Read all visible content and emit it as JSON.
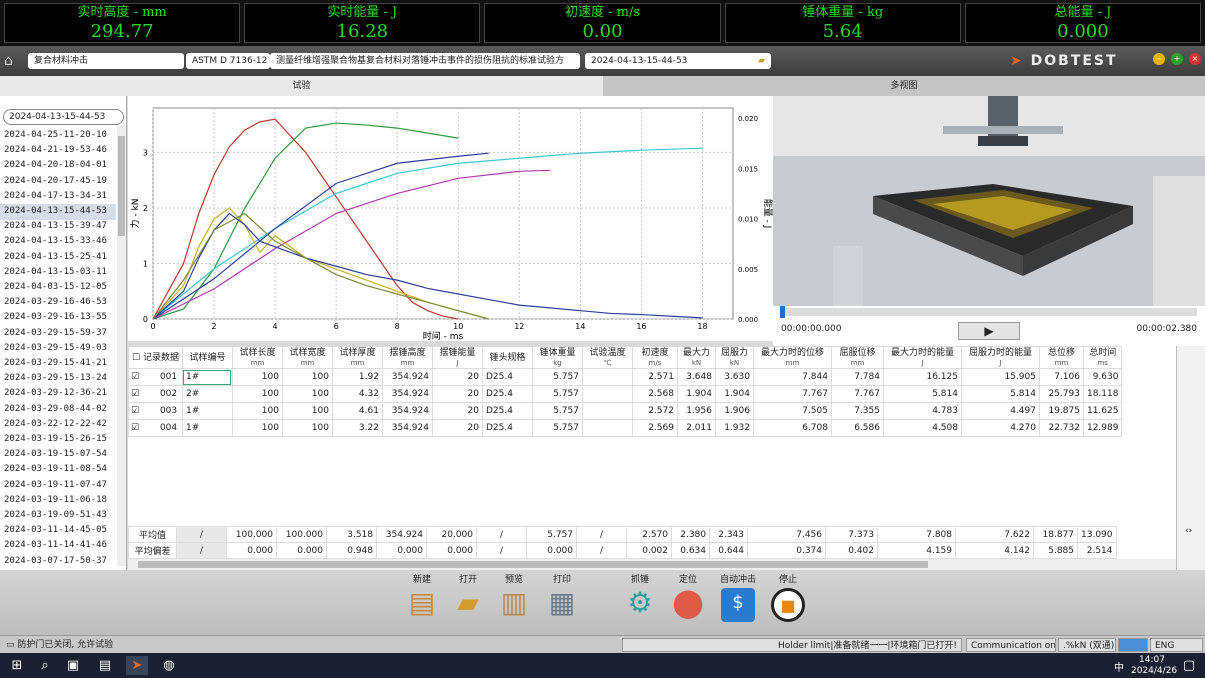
{
  "meters": [
    {
      "label": "实时高度 - mm",
      "value": "294.77"
    },
    {
      "label": "实时能量 - J",
      "value": "16.28"
    },
    {
      "label": "初速度 - m/s",
      "value": "0.00"
    },
    {
      "label": "锤体重量 - kg",
      "value": "5.64"
    },
    {
      "label": "总能量 - J",
      "value": "0.000"
    }
  ],
  "toolbar": {
    "material": "复合材料冲击",
    "standard": "ASTM D 7136-12",
    "standard_desc": "测量纤维增强聚合物基复合材料对落锤冲击事件的损伤阻抗的标准试验方",
    "record": "2024-04-13-15-44-53",
    "logo": "DOBTEST"
  },
  "tabs": {
    "test": "试验",
    "multi": "多视图"
  },
  "list": {
    "search": "2024-04-13-15-44-53",
    "items": [
      "2024-04-25-11-20-10",
      "2024-04-21-19-53-46",
      "2024-04-20-18-04-01",
      "2024-04-20-17-45-19",
      "2024-04-17-13-34-31",
      "2024-04-13-15-44-53",
      "2024-04-13-15-39-47",
      "2024-04-13-15-33-46",
      "2024-04-13-15-25-41",
      "2024-04-13-15-03-11",
      "2024-04-03-15-12-05",
      "2024-03-29-16-46-53",
      "2024-03-29-16-13-55",
      "2024-03-29-15-59-37",
      "2024-03-29-15-49-03",
      "2024-03-29-15-41-21",
      "2024-03-29-15-13-24",
      "2024-03-29-12-36-21",
      "2024-03-29-08-44-02",
      "2024-03-22-12-22-42",
      "2024-03-19-15-26-15",
      "2024-03-19-15-07-54",
      "2024-03-19-11-08-54",
      "2024-03-19-11-07-47",
      "2024-03-19-11-06-18",
      "2024-03-19-09-51-43",
      "2024-03-11-14-45-05",
      "2024-03-11-14-41-46",
      "2024-03-07-17-50-37"
    ],
    "selected": 5
  },
  "chart_data": {
    "type": "line",
    "xlabel": "时间 - ms",
    "ylabel": "力 - kN",
    "y2label": "能量 - J",
    "xlim": [
      0,
      19
    ],
    "ylim": [
      0,
      3.8
    ],
    "y2lim": [
      0,
      0.021
    ],
    "xticks": [
      "0",
      "2",
      "4",
      "6",
      "8",
      "10",
      "12",
      "14",
      "16",
      "18"
    ],
    "yticks": [
      "0",
      "1",
      "2",
      "3"
    ],
    "y2ticks": [
      "0.000",
      "0.005",
      "0.010",
      "0.015",
      "0.020"
    ],
    "series": [
      {
        "color": "#c0392b",
        "axis": "force",
        "x": [
          0,
          1,
          1.5,
          2,
          2.5,
          3,
          3.5,
          4,
          4.5,
          5,
          5.5,
          6,
          6.5,
          7,
          7.5,
          8,
          8.5,
          9,
          9.5,
          10
        ],
        "y": [
          0,
          1,
          1.9,
          2.6,
          3.1,
          3.4,
          3.55,
          3.6,
          3.3,
          3.0,
          2.6,
          2.2,
          1.8,
          1.4,
          1.0,
          0.6,
          0.3,
          0.15,
          0.05,
          0
        ]
      },
      {
        "color": "#2e9a3e",
        "axis": "energy",
        "x": [
          0,
          1,
          2,
          3,
          4,
          5,
          6,
          7,
          8,
          9,
          10
        ],
        "y": [
          0,
          0.001,
          0.005,
          0.011,
          0.016,
          0.019,
          0.0195,
          0.0193,
          0.019,
          0.0185,
          0.018
        ]
      },
      {
        "color": "#3bc8d4",
        "axis": "energy",
        "x": [
          0,
          2,
          4,
          6,
          8,
          10,
          12,
          14,
          16,
          18
        ],
        "y": [
          0,
          0.005,
          0.009,
          0.0125,
          0.0145,
          0.0155,
          0.016,
          0.0165,
          0.0168,
          0.017
        ]
      },
      {
        "color": "#2a3f9a",
        "axis": "energy",
        "x": [
          0,
          2,
          4,
          6,
          8,
          10,
          11
        ],
        "y": [
          0,
          0.004,
          0.009,
          0.0135,
          0.0155,
          0.0162,
          0.0165
        ]
      },
      {
        "color": "#b03ab0",
        "axis": "energy",
        "x": [
          0,
          2,
          4,
          6,
          8,
          10,
          12,
          13
        ],
        "y": [
          0,
          0.003,
          0.007,
          0.0105,
          0.0125,
          0.014,
          0.0147,
          0.0148
        ]
      },
      {
        "color": "#c9b020",
        "axis": "force",
        "x": [
          0,
          1,
          1.5,
          2,
          2.5,
          3,
          3.5,
          4,
          5,
          6,
          7,
          8,
          9,
          10,
          11
        ],
        "y": [
          0,
          0.6,
          1.3,
          1.8,
          2.0,
          1.7,
          1.2,
          1.5,
          1.1,
          0.9,
          0.7,
          0.5,
          0.3,
          0.15,
          0
        ]
      },
      {
        "color": "#2a3f9a",
        "axis": "force",
        "x": [
          0,
          1,
          1.5,
          2,
          2.5,
          3,
          3.5,
          4,
          5,
          6,
          7,
          8,
          9,
          10,
          11,
          12,
          13,
          14,
          15,
          16,
          17,
          18
        ],
        "y": [
          0,
          0.5,
          1.1,
          1.6,
          1.9,
          1.7,
          1.4,
          1.3,
          1.1,
          0.95,
          0.8,
          0.7,
          0.55,
          0.45,
          0.35,
          0.25,
          0.2,
          0.15,
          0.1,
          0.08,
          0.05,
          0.02
        ]
      },
      {
        "color": "#7a8a3a",
        "axis": "force",
        "x": [
          0,
          1,
          2,
          3,
          4,
          5,
          6,
          7,
          8,
          9,
          10,
          11
        ],
        "y": [
          0,
          0.7,
          1.6,
          1.9,
          1.4,
          1.1,
          0.8,
          0.6,
          0.45,
          0.3,
          0.15,
          0
        ]
      }
    ]
  },
  "video": {
    "time_start": "00:00:00.000",
    "time_end": "00:00:02.380"
  },
  "table": {
    "headers": [
      [
        "记录数据",
        ""
      ],
      [
        "试样编号",
        ""
      ],
      [
        "试样长度",
        "mm"
      ],
      [
        "试样宽度",
        "mm"
      ],
      [
        "试样厚度",
        "mm"
      ],
      [
        "摆锤高度",
        "mm"
      ],
      [
        "摆锤能量",
        "J"
      ],
      [
        "锤头规格",
        ""
      ],
      [
        "锤体重量",
        "kg"
      ],
      [
        "试验温度",
        "℃"
      ],
      [
        "初速度",
        "m/s"
      ],
      [
        "最大力",
        "kN"
      ],
      [
        "屈服力",
        "kN"
      ],
      [
        "最大力时的位移",
        "mm"
      ],
      [
        "屈服位移",
        "mm"
      ],
      [
        "最大力时的能量",
        "J"
      ],
      [
        "屈服力时的能量",
        "J"
      ],
      [
        "总位移",
        "mm"
      ],
      [
        "总时间",
        "ms"
      ]
    ],
    "rows": [
      [
        "001",
        "1#",
        "100",
        "100",
        "1.92",
        "354.924",
        "20",
        "D25.4",
        "5.757",
        "",
        "2.571",
        "3.648",
        "3.630",
        "7.844",
        "7.784",
        "16.125",
        "15.905",
        "7.106",
        "9.630"
      ],
      [
        "002",
        "2#",
        "100",
        "100",
        "4.32",
        "354.924",
        "20",
        "D25.4",
        "5.757",
        "",
        "2.568",
        "1.904",
        "1.904",
        "7.767",
        "7.767",
        "5.814",
        "5.814",
        "25.793",
        "18.118"
      ],
      [
        "003",
        "1#",
        "100",
        "100",
        "4.61",
        "354.924",
        "20",
        "D25.4",
        "5.757",
        "",
        "2.572",
        "1.956",
        "1.906",
        "7.505",
        "7.355",
        "4.783",
        "4.497",
        "19.875",
        "11.625"
      ],
      [
        "004",
        "1#",
        "100",
        "100",
        "3.22",
        "354.924",
        "20",
        "D25.4",
        "5.757",
        "",
        "2.569",
        "2.011",
        "1.932",
        "6.708",
        "6.586",
        "4.508",
        "4.270",
        "22.732",
        "12.989"
      ]
    ],
    "summary": [
      [
        "平均值",
        "/",
        "100.000",
        "100.000",
        "3.518",
        "354.924",
        "20.000",
        "/",
        "5.757",
        "/",
        "2.570",
        "2.380",
        "2.343",
        "7.456",
        "7.373",
        "7.808",
        "7.622",
        "18.877",
        "13.090"
      ],
      [
        "平均偏差",
        "/",
        "0.000",
        "0.000",
        "0.948",
        "0.000",
        "0.000",
        "/",
        "0.000",
        "/",
        "0.002",
        "0.634",
        "0.644",
        "0.374",
        "0.402",
        "4.159",
        "4.142",
        "5.885",
        "2.514"
      ]
    ]
  },
  "buttons": {
    "new": "新建",
    "open": "打开",
    "preview": "预览",
    "print": "打印",
    "grab": "抓锤",
    "locate": "定位",
    "auto": "自动冲击",
    "stop": "停止"
  },
  "status": {
    "door": "防护门已关闭, 允许试验",
    "messages": "Holder limit|准备就绪一一|环境箱门已打开!",
    "comm": "Communication on",
    "unit": ".%kN (双通)",
    "tray": "ENG"
  },
  "taskbar": {
    "time": "14:07",
    "date": "2024/4/26",
    "lang": "中"
  }
}
